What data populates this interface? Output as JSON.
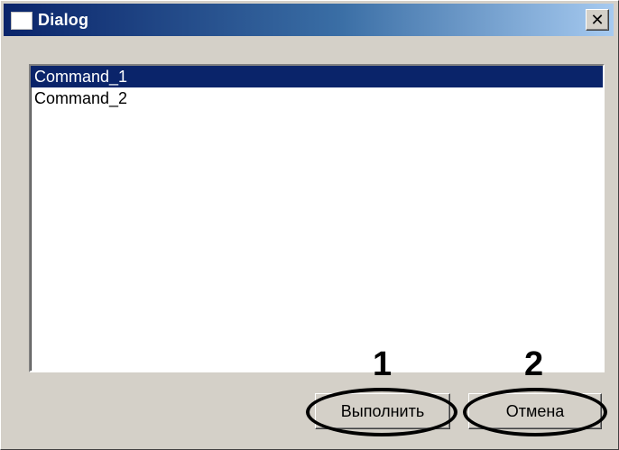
{
  "window": {
    "title": "Dialog",
    "close_glyph": "✕",
    "title_icon": "window-icon"
  },
  "list": {
    "items": [
      {
        "label": "Command_1",
        "selected": true
      },
      {
        "label": "Command_2",
        "selected": false
      }
    ]
  },
  "buttons": {
    "run_label": "Выполнить",
    "cancel_label": "Отмена"
  },
  "annotations": {
    "marker_1": "1",
    "marker_2": "2"
  },
  "colors": {
    "selection": "#0a246a",
    "face": "#d4d0c8",
    "titlebar_start": "#0a246a",
    "titlebar_end": "#a6caf0"
  }
}
